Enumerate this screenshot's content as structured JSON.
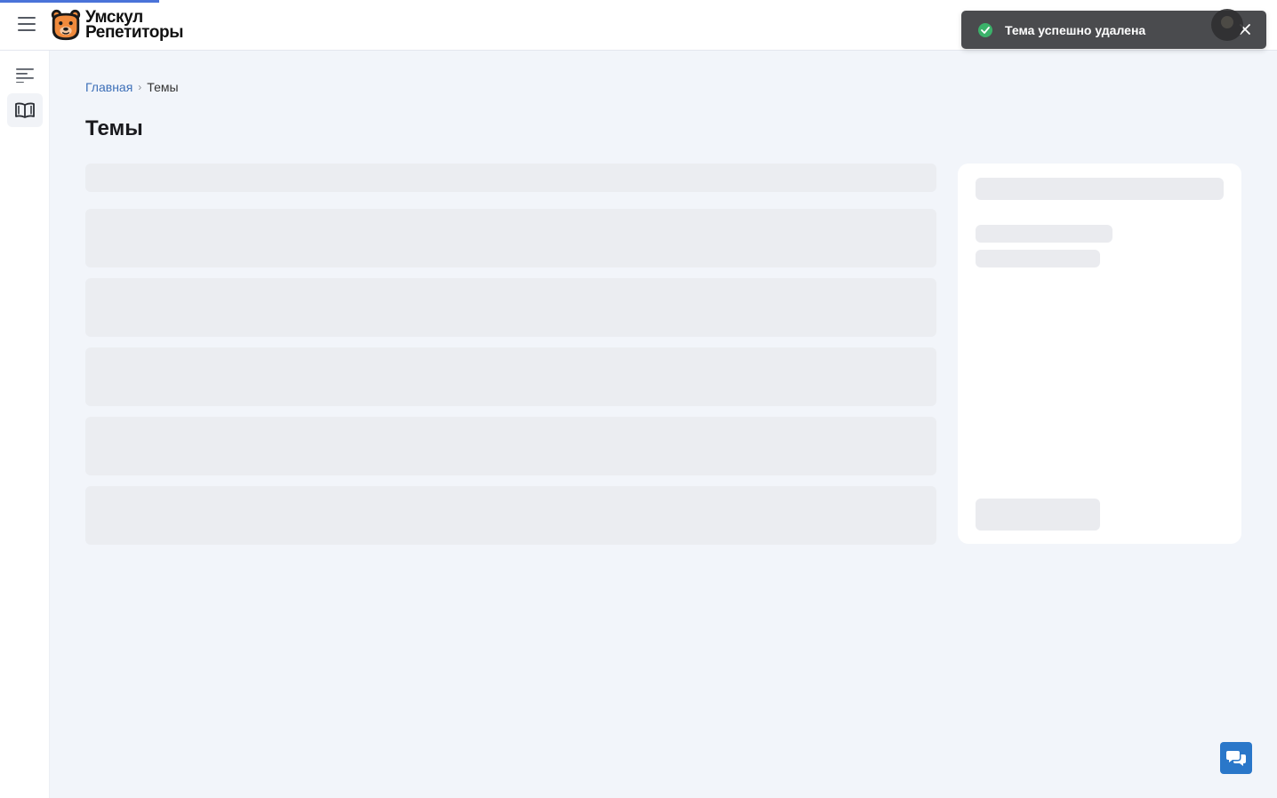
{
  "app": {
    "logo_line1": "Умскул",
    "logo_line2": "Репетиторы"
  },
  "breadcrumb": {
    "home": "Главная",
    "current": "Темы"
  },
  "page": {
    "title": "Темы"
  },
  "toast": {
    "message": "Тема успешно удалена",
    "status_color": "#3bb26a"
  },
  "colors": {
    "accent": "#4a73d9",
    "link": "#3d6fb8",
    "fab": "#2a77c9"
  },
  "icons": {
    "menu": "hamburger-icon",
    "sidebar_menu": "align-left-icon",
    "sidebar_topics": "book-open-icon",
    "toast_status": "check-circle-icon",
    "toast_close": "close-icon",
    "chat": "chat-bubbles-icon"
  }
}
